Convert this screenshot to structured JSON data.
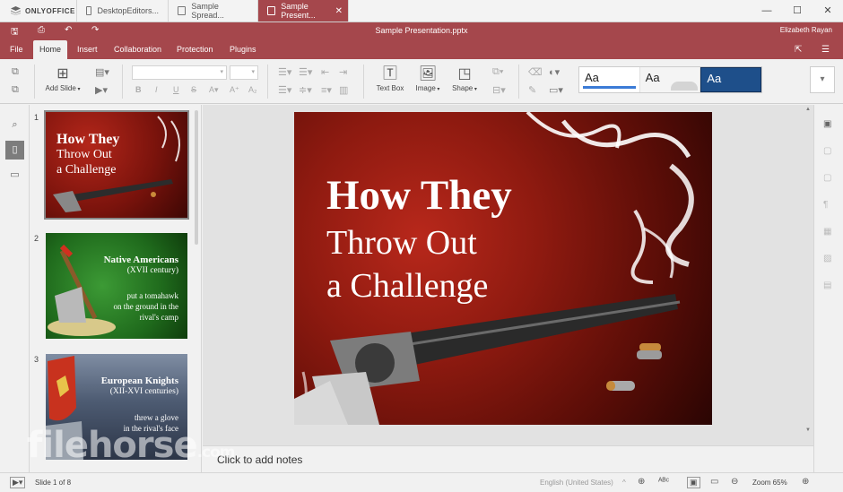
{
  "brand": {
    "name": "ONLYOFFICE"
  },
  "tabs": [
    {
      "label": "DesktopEditors..."
    },
    {
      "label": "Sample Spread..."
    },
    {
      "label": "Sample Present..."
    }
  ],
  "titlebar": {
    "document_title": "Sample Presentation.pptx",
    "user": "Elizabeth Rayan"
  },
  "menu": {
    "file": "File",
    "home": "Home",
    "insert": "Insert",
    "collaboration": "Collaboration",
    "protection": "Protection",
    "plugins": "Plugins"
  },
  "toolbar": {
    "add_slide": "Add Slide",
    "text_box": "Text Box",
    "image": "Image",
    "shape": "Shape",
    "theme_sample": "Aa"
  },
  "thumbnails": [
    {
      "number": "1",
      "title1": "How They",
      "title2": "Throw Out",
      "title3": "a Challenge"
    },
    {
      "number": "2",
      "title": "Native Americans",
      "subtitle": "(XVII century)",
      "text1": "put a tomahawk",
      "text2": "on the ground in the",
      "text3": "rival's camp"
    },
    {
      "number": "3",
      "title": "European Knights",
      "subtitle": "(XII-XVI centuries)",
      "text1": "threw a glove",
      "text2": "in the rival's face"
    }
  ],
  "slide": {
    "line1": "How They",
    "line2": "Throw Out",
    "line3": "a Challenge"
  },
  "notes": {
    "placeholder": "Click to add notes"
  },
  "status": {
    "slide_counter": "Slide 1 of 8",
    "language": "English (United States)",
    "zoom": "Zoom 65%"
  },
  "watermark": {
    "text": "filehorse",
    "suffix": ".com"
  },
  "colors": {
    "accent": "#a5474c"
  }
}
